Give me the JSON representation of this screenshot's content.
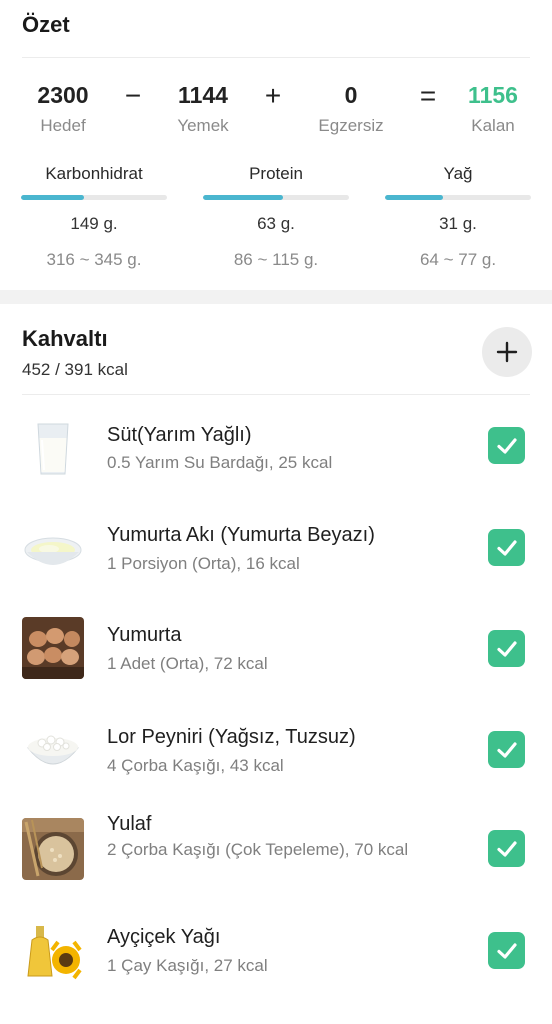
{
  "summary": {
    "title": "Özet",
    "equation": {
      "goal": {
        "value": "2300",
        "label": "Hedef"
      },
      "minus": "−",
      "food": {
        "value": "1144",
        "label": "Yemek"
      },
      "plus": "+",
      "exercise": {
        "value": "0",
        "label": "Egzersiz"
      },
      "equals": "=",
      "remaining": {
        "value": "1156",
        "label": "Kalan"
      }
    },
    "macros": [
      {
        "name": "Karbonhidrat",
        "amount": "149 g.",
        "range": "316 ~ 345 g.",
        "progress": 0.43
      },
      {
        "name": "Protein",
        "amount": "63 g.",
        "range": "86 ~ 115 g.",
        "progress": 0.55
      },
      {
        "name": "Yağ",
        "amount": "31 g.",
        "range": "64 ~ 77 g.",
        "progress": 0.4
      }
    ]
  },
  "meal": {
    "title": "Kahvaltı",
    "kcal": "452 / 391 kcal",
    "add_icon": "plus-icon",
    "items": [
      {
        "name": "Süt(Yarım Yağlı)",
        "detail": "0.5 Yarım Su Bardağı, 25 kcal",
        "checked": true,
        "image": "milk-glass"
      },
      {
        "name": "Yumurta Akı (Yumurta Beyazı)",
        "detail": "1 Porsiyon (Orta), 16 kcal",
        "checked": true,
        "image": "egg-white-bowl"
      },
      {
        "name": "Yumurta",
        "detail": "1 Adet (Orta), 72 kcal",
        "checked": true,
        "image": "eggs"
      },
      {
        "name": "Lor Peyniri (Yağsız, Tuzsuz)",
        "detail": "4 Çorba Kaşığı, 43 kcal",
        "checked": true,
        "image": "cottage-cheese-bowl"
      },
      {
        "name": "Yulaf",
        "detail": "2 Çorba Kaşığı (Çok Tepeleme), 70 kcal",
        "checked": true,
        "image": "oats"
      },
      {
        "name": "Ayçiçek Yağı",
        "detail": "1 Çay Kaşığı, 27 kcal",
        "checked": true,
        "image": "sunflower-oil"
      }
    ]
  },
  "colors": {
    "accent_green": "#3ec08c",
    "macro_bar": "#4ab6cf",
    "muted_text": "#8a8a8a"
  }
}
